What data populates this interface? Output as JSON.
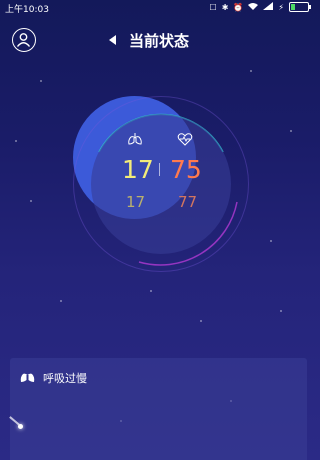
{
  "status_bar": {
    "time": "上午10:03",
    "icons": [
      "notification-icon",
      "bluetooth-icon",
      "alarm-icon",
      "wifi-icon",
      "signal-icon",
      "charging-icon",
      "battery-icon"
    ]
  },
  "header": {
    "title": "当前状态"
  },
  "gauge": {
    "respiration_current": "17",
    "heart_rate_current": "75",
    "respiration_average": "17",
    "heart_rate_average": "77",
    "separator": "|"
  },
  "alert_panel": {
    "label": "呼吸过慢"
  },
  "colors": {
    "background": "#1a1c68",
    "gauge_fill": "#3c5ad9",
    "respiration": "#f3ec7a",
    "heart_rate": "#ff7a4e"
  }
}
